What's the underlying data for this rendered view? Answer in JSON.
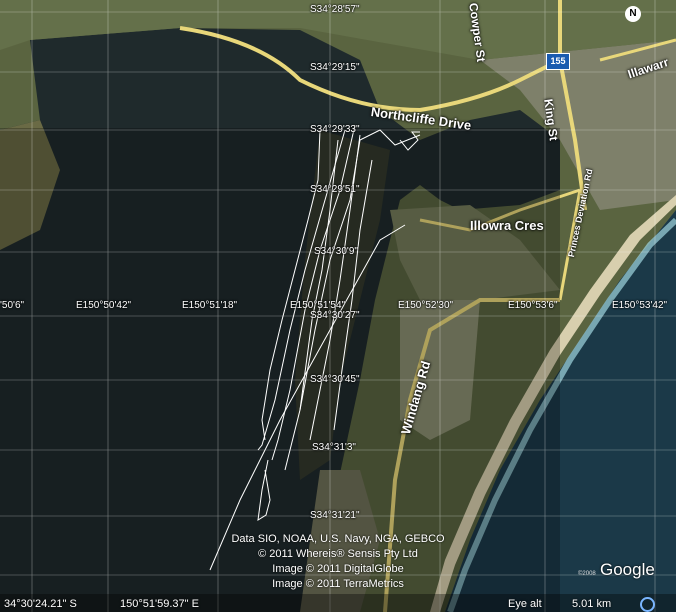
{
  "compass": {
    "label": "N"
  },
  "route_shield": {
    "label": "155"
  },
  "grid_labels": {
    "latitudes": [
      "S34°28'57\"",
      "S34°29'15\"",
      "S34°29'33\"",
      "S34°29'51\"",
      "S34°30'9\"",
      "S34°30'27\"",
      "S34°30'45\"",
      "S34°31'3\"",
      "S34°31'21\""
    ],
    "longitudes": [
      "'50'6\"",
      "E150°50'42\"",
      "E150°51'18\"",
      "E150°51'54\"",
      "E150°52'30\"",
      "E150°53'6\"",
      "E150°53'42\""
    ]
  },
  "roads": {
    "northcliffe": "Northcliffe Drive",
    "illowra": "Illowra Cres",
    "windang": "Windang Rd",
    "king": "King St",
    "cowper": "Cowper St",
    "illawarra": "Illawarr",
    "princes_dev": "Princes Deviation Rd"
  },
  "attribution": [
    "Data SIO, NOAA, U.S. Navy, NGA, GEBCO",
    "© 2011 Whereis® Sensis Pty Ltd",
    "Image © 2011 DigitalGlobe",
    "Image © 2011 TerraMetrics"
  ],
  "status": {
    "lat": "34°30'24.21\" S",
    "lon": "150°51'59.37\" E",
    "eye_label": "Eye alt",
    "eye_value": "5.01 km"
  },
  "logo": {
    "text": "Google",
    "copyright": "©2008"
  },
  "colors": {
    "water": "#1f2a2c",
    "sea": "#1b3948",
    "land": "#5a6440",
    "road": "#e8d77a",
    "track": "#ffffff"
  }
}
